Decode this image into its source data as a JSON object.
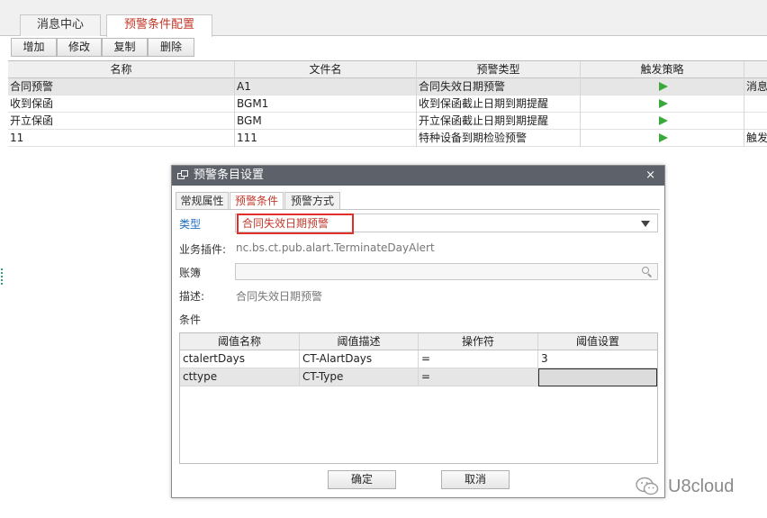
{
  "tabs": [
    "消息中心",
    "预警条件配置"
  ],
  "toolbar": [
    "增加",
    "修改",
    "复制",
    "删除"
  ],
  "grid": {
    "columns": [
      "名称",
      "文件名",
      "预警类型",
      "触发策略",
      ""
    ],
    "rows": [
      {
        "name": "合同预警",
        "file": "A1",
        "type": "合同失效日期预警",
        "extra": "消息"
      },
      {
        "name": "收到保函",
        "file": "BGM1",
        "type": "收到保函截止日期到期提醒",
        "extra": ""
      },
      {
        "name": "开立保函",
        "file": "BGM",
        "type": "开立保函截止日期到期提醒",
        "extra": ""
      },
      {
        "name": "11",
        "file": "111",
        "type": "特种设备到期检验预警",
        "extra": "触发"
      }
    ],
    "play_color": "#3aa83a"
  },
  "dialog": {
    "title": "预警条目设置",
    "close": "×",
    "tabs": [
      "常规属性",
      "预警条件",
      "预警方式"
    ],
    "type_label": "类型",
    "type_value": "合同失效日期预警",
    "plugin_label": "业务插件:",
    "plugin_value": "nc.bs.ct.pub.alart.TerminateDayAlert",
    "ledger_label": "账簿",
    "desc_label": "描述:",
    "desc_value": "合同失效日期预警",
    "cond_label": "条件",
    "cond_table": {
      "columns": [
        "阈值名称",
        "阈值描述",
        "操作符",
        "阈值设置"
      ],
      "rows": [
        {
          "name": "ctalertDays",
          "desc": "CT-AlartDays",
          "op": "=",
          "value": "3"
        },
        {
          "name": "cttype",
          "desc": "CT-Type",
          "op": "=",
          "value": ""
        }
      ]
    },
    "ok": "确定",
    "cancel": "取消"
  },
  "watermark": "U8cloud",
  "colors": {
    "accent_red": "#c0392b",
    "title_bar": "#5d6169",
    "label_blue": "#1f6fbf"
  }
}
